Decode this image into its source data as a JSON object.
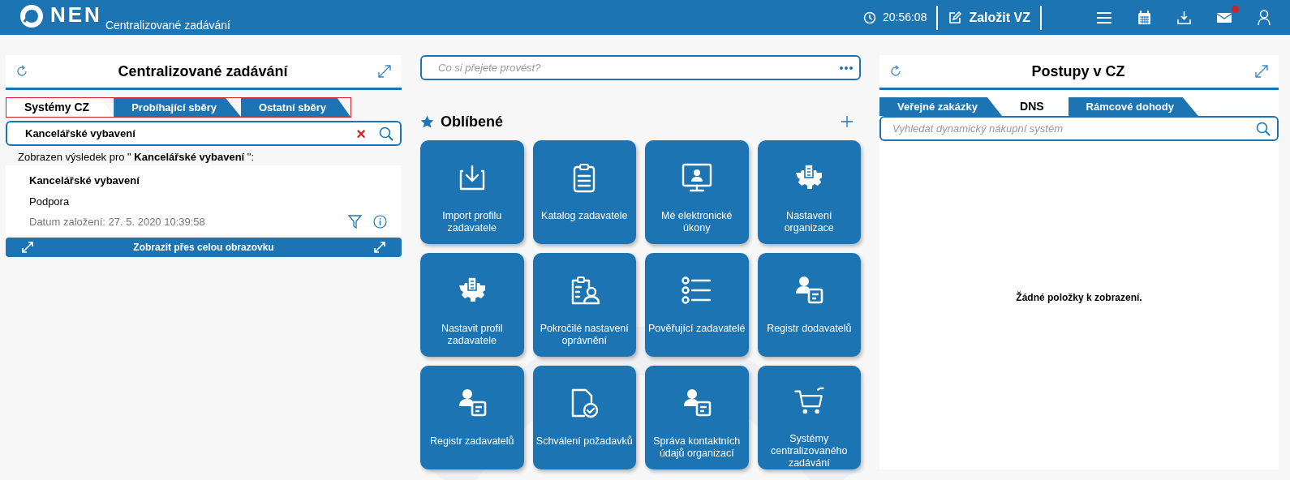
{
  "header": {
    "logo": "NEN",
    "subtitle": "Centralizované zadávání",
    "time": "20:56:08",
    "create_button": "Založit VZ",
    "mail_notification": true
  },
  "left_panel": {
    "title": "Centralizované zadávání",
    "tabs": [
      {
        "label": "Systémy CZ",
        "selected": true
      },
      {
        "label": "Probíhající sběry",
        "selected": false
      },
      {
        "label": "Ostatní sběry",
        "selected": false
      }
    ],
    "search": {
      "value": "Kancelářské vybavení",
      "clear": "×"
    },
    "result_note": "Zobrazen výsledek pro \" **Kancelářské vybavení** \":",
    "results": [
      {
        "title": "Kancelářské vybavení",
        "subtitle": "Podpora",
        "date": "Datum založení: 27. 5. 2020 10:39:58"
      }
    ],
    "fullscreen_button": "Zobrazit přes celou obrazovku"
  },
  "center": {
    "search": {
      "placeholder": "Co si přejete provést?"
    },
    "favorites_title": "Oblíbené",
    "tiles": [
      {
        "label": "Import profilu zadavatele"
      },
      {
        "label": "Katalog zadavatele"
      },
      {
        "label": "Mé elektronické úkony"
      },
      {
        "label": "Nastavení organizace"
      },
      {
        "label": "Nastavit profil zadavatele"
      },
      {
        "label": "Pokročilé nastavení oprávnění"
      },
      {
        "label": "Pověřující zadavatelé"
      },
      {
        "label": "Registr dodavatelů"
      },
      {
        "label": "Registr zadavatelů"
      },
      {
        "label": "Schválení požadavků"
      },
      {
        "label": "Správa kontaktních údajů organizací"
      },
      {
        "label": "Systémy centralizovaného zadávání"
      }
    ]
  },
  "right_panel": {
    "title": "Postupy v CZ",
    "tabs": [
      {
        "label": "Veřejné zakázky",
        "selected": false
      },
      {
        "label": "DNS",
        "selected": true
      },
      {
        "label": "Rámcové dohody",
        "selected": false
      }
    ],
    "search": {
      "placeholder": "Vyhledat dynamický nákupní systém"
    },
    "empty_message": "Žádné položky k zobrazení."
  }
}
